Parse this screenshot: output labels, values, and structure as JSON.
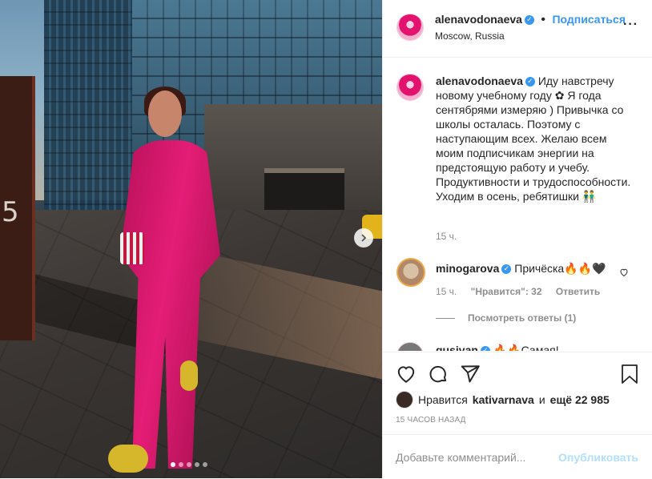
{
  "post": {
    "photo_alt": "",
    "carousel": {
      "count": 5,
      "active": 0
    }
  },
  "header": {
    "username": "alenavodonaeva",
    "follow_label": "Подписаться",
    "location": "Moscow, Russia",
    "separator": "•"
  },
  "caption": {
    "username": "alenavodonaeva",
    "text": "Иду навстречу новому учебному году ✿ Я года сентябрями измеряю ) Привычка со школы осталась. Поэтому с наступающим всех. Желаю всем моим подписчикам энергии на предстоящую работу и учебу. Продуктивности и трудоспособности. Уходим в осень, ребятишки 👬",
    "time": "15 ч."
  },
  "comments": [
    {
      "username": "minogarova",
      "text": "Причёска🔥🔥🖤",
      "time": "15 ч.",
      "likes": "\"Нравится\": 32",
      "reply_label": "Ответить",
      "view_replies": "Посмотреть ответы (1)"
    },
    {
      "username": "gusivan",
      "text": "🔥🔥Самая!"
    }
  ],
  "likes": {
    "prefix": "Нравится",
    "user": "kativarnava",
    "connector": "и",
    "others": "ещё 22 985"
  },
  "timestamp": "15 ЧАСОВ НАЗАД",
  "add_comment": {
    "placeholder": "Добавьте комментарий...",
    "publish_label": "Опубликовать"
  },
  "colors": {
    "accent": "#3897f0",
    "publish_disabled": "#b2dffc",
    "suit": "#e41d76"
  }
}
